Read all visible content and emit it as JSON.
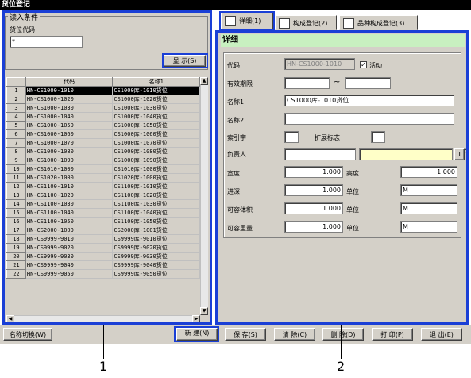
{
  "window": {
    "title": "货位登记"
  },
  "filter": {
    "group_label": "读入条件",
    "code_label": "货位代码",
    "code_value": "*",
    "show_button": "显  示(S)"
  },
  "grid": {
    "headers": [
      "代码",
      "名称1"
    ],
    "rows": [
      {
        "n": "1",
        "code": "HN-CS1000-1010",
        "name": "CS1000库-1010货位"
      },
      {
        "n": "2",
        "code": "HN-CS1000-1020",
        "name": "CS1000库-1020货位"
      },
      {
        "n": "3",
        "code": "HN-CS1000-1030",
        "name": "CS1000库-1030货位"
      },
      {
        "n": "4",
        "code": "HN-CS1000-1040",
        "name": "CS1000库-1040货位"
      },
      {
        "n": "5",
        "code": "HN-CS1000-1050",
        "name": "CS1000库-1050货位"
      },
      {
        "n": "6",
        "code": "HN-CS1000-1060",
        "name": "CS1000库-1060货位"
      },
      {
        "n": "7",
        "code": "HN-CS1000-1070",
        "name": "CS1000库-1070货位"
      },
      {
        "n": "8",
        "code": "HN-CS1000-1080",
        "name": "CS1000库-1080货位"
      },
      {
        "n": "9",
        "code": "HN-CS1000-1090",
        "name": "CS1000库-1090货位"
      },
      {
        "n": "10",
        "code": "HN-CS1010-1000",
        "name": "CS1010库-1000货位"
      },
      {
        "n": "11",
        "code": "HN-CS1020-1000",
        "name": "CS1020库-1000货位"
      },
      {
        "n": "12",
        "code": "HN-CS1100-1010",
        "name": "CS1100库-1010货位"
      },
      {
        "n": "13",
        "code": "HN-CS1100-1020",
        "name": "CS1100库-1020货位"
      },
      {
        "n": "14",
        "code": "HN-CS1100-1030",
        "name": "CS1100库-1030货位"
      },
      {
        "n": "15",
        "code": "HN-CS1100-1040",
        "name": "CS1100库-1040货位"
      },
      {
        "n": "16",
        "code": "HN-CS1100-1050",
        "name": "CS1100库-1050货位"
      },
      {
        "n": "17",
        "code": "HN-CS2000-1000",
        "name": "CS2000库-1001货位"
      },
      {
        "n": "18",
        "code": "HN-CS9999-9010",
        "name": "CS9999库-9010货位"
      },
      {
        "n": "19",
        "code": "HN-CS9999-9020",
        "name": "CS9999库-9020货位"
      },
      {
        "n": "20",
        "code": "HN-CS9999-9030",
        "name": "CS9999库-9030货位"
      },
      {
        "n": "21",
        "code": "HN-CS9999-9040",
        "name": "CS9999库-9040货位"
      },
      {
        "n": "22",
        "code": "HN-CS9999-9050",
        "name": "CS9999库-9050货位"
      }
    ]
  },
  "tabs": [
    {
      "label": "详细(1)"
    },
    {
      "label": "构成登记(2)"
    },
    {
      "label": "品种构成登记(3)"
    }
  ],
  "detail": {
    "header": "详细",
    "code_label": "代码",
    "code_value": "HN-CS1000-1010",
    "active_label": "活动",
    "period_label": "有效期限",
    "tilde": "~",
    "name1_label": "名称1",
    "name1_value": "CS1000库-1010货位",
    "name2_label": "名称2",
    "name2_value": "",
    "index_label": "索引字",
    "ext_label": "扩展标志",
    "owner_label": "负责人",
    "owner_btn": "1",
    "width_label": "宽度",
    "width_value": "1.000",
    "height_label": "高度",
    "height_value": "1.000",
    "depth_label": "进深",
    "depth_value": "1.000",
    "unit_label": "单位",
    "unit1": "M",
    "unit2": "M",
    "unit3": "M",
    "volume_label": "可容体积",
    "volume_value": "1.000",
    "weight_label": "可容重量",
    "weight_value": "1.000"
  },
  "buttons": {
    "switch": "名称切换(W)",
    "new": "新  建(N)",
    "save": "保 存(S)",
    "clear": "清 除(C)",
    "delete": "删 除(D)",
    "print": "打 印(P)",
    "exit": "退 出(E)"
  },
  "callouts": {
    "one": "1",
    "two": "2"
  },
  "colors": {
    "annotation_blue": "#1a3fd6",
    "detail_header": "#c8f0c0",
    "owner_field": "#ffffc8"
  }
}
